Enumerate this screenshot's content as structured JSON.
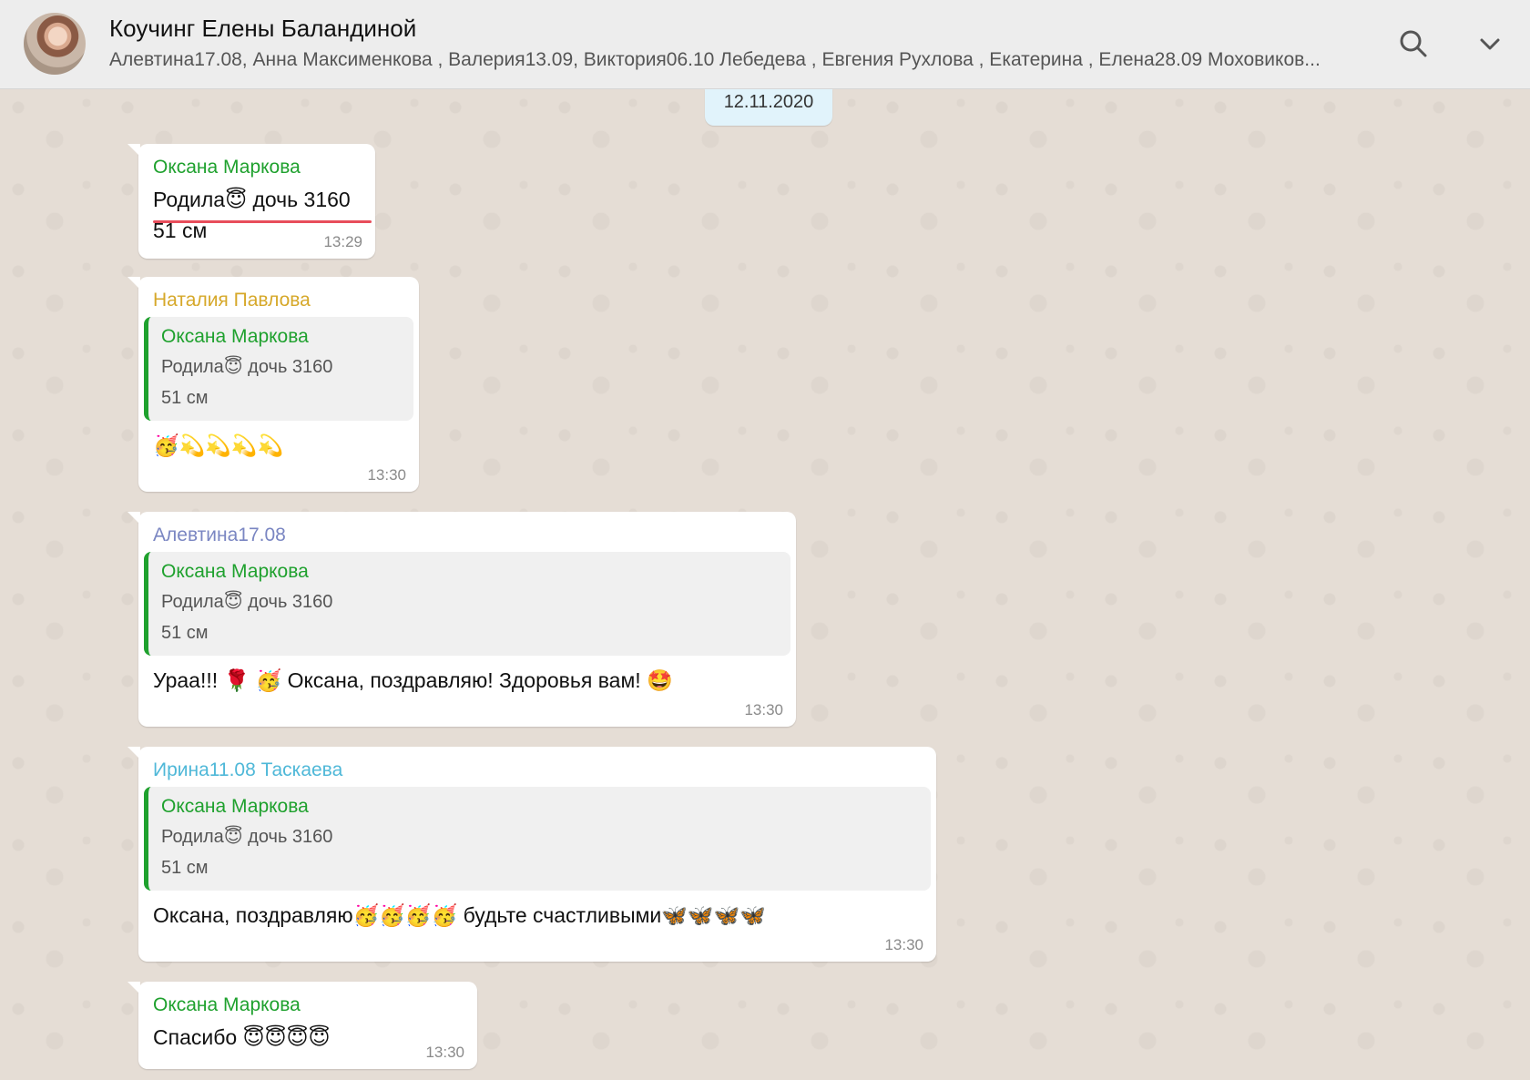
{
  "header": {
    "title": "Коучинг Елены Баландиной",
    "participants": "Алевтина17.08, Анна Максименкова , Валерия13.09, Виктория06.10 Лебедева , Евгения Рухлова , Екатерина , Елена28.09 Моховиков..."
  },
  "date_chip": "12.11.2020",
  "messages": [
    {
      "sender": "Оксана Маркова",
      "line1": "Родила😇 дочь 3160",
      "line2": " 51 см",
      "time": "13:29"
    },
    {
      "sender": "Наталия Павлова",
      "quote": {
        "sender": "Оксана Маркова",
        "line1": "Родила😇 дочь 3160",
        "line2": " 51 см"
      },
      "text": "🥳💫💫💫💫",
      "time": "13:30"
    },
    {
      "sender": "Алевтина17.08",
      "quote": {
        "sender": "Оксана Маркова",
        "line1": "Родила😇 дочь 3160",
        "line2": " 51 см"
      },
      "text": "Ураа!!! 🌹 🥳 Оксана, поздравляю! Здоровья вам! 🤩",
      "time": "13:30"
    },
    {
      "sender": "Ирина11.08 Таскаева",
      "quote": {
        "sender": "Оксана Маркова",
        "line1": "Родила😇 дочь 3160",
        "line2": " 51 см"
      },
      "text": "Оксана, поздравляю🥳🥳🥳🥳 будьте счастливыми🦋🦋🦋🦋",
      "time": "13:30"
    },
    {
      "sender": "Оксана Маркова",
      "text": "Спасибо 😇😇😇😇",
      "time": "13:30"
    }
  ],
  "colors": {
    "chat_background": "#e5ddd5",
    "header_background": "#ededed",
    "quote_accent": "#1fa12e",
    "underline": "#e84d5b"
  },
  "icons": [
    "search-icon",
    "chevron-down-icon"
  ]
}
